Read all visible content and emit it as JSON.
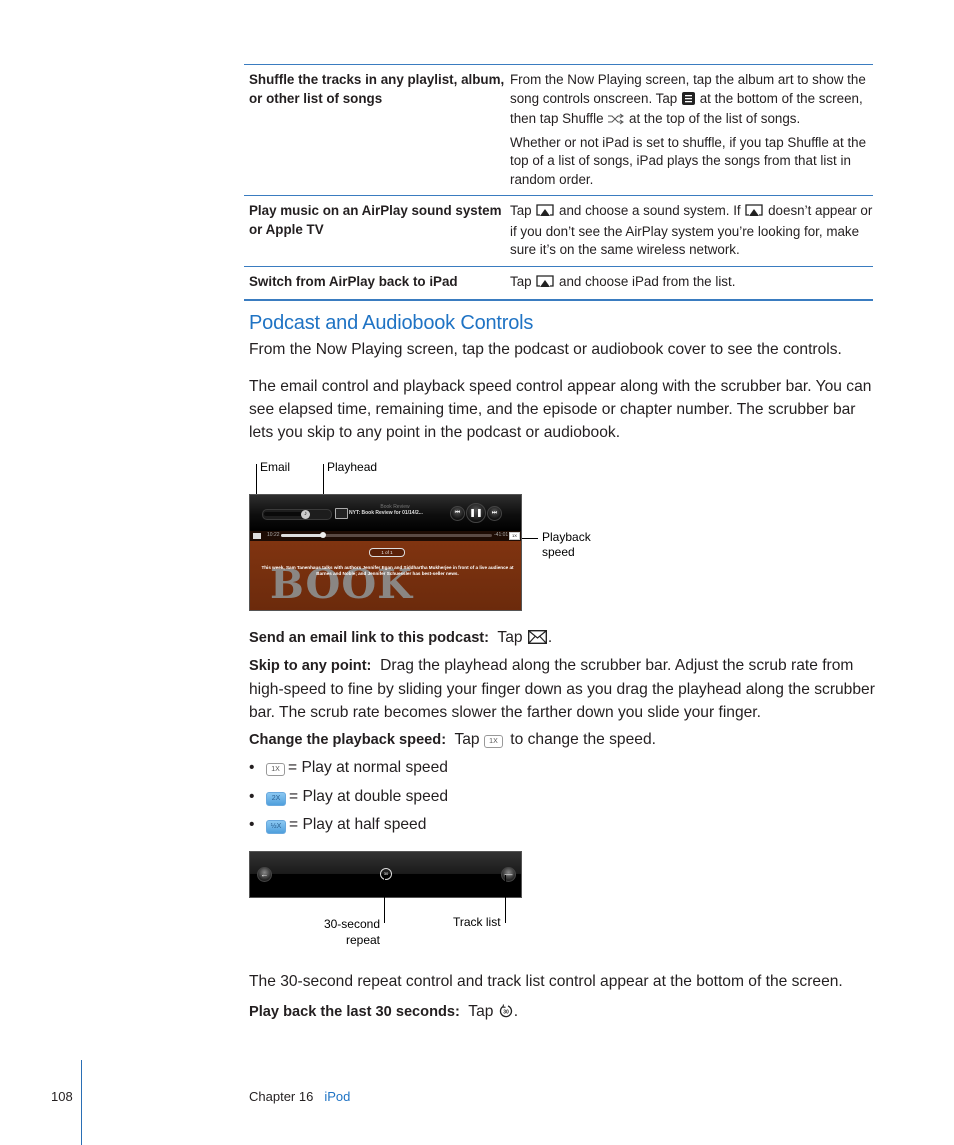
{
  "table": {
    "rows": [
      {
        "task": "Shuffle the tracks in any playlist, album, or other list of songs",
        "desc_parts": [
          "From the Now Playing screen, tap the album art to show the song controls onscreen. Tap ",
          " at the bottom of the screen, then tap Shuffle ",
          " at the top of the list of songs."
        ],
        "desc_icons": [
          "list-icon",
          "shuffle-icon"
        ],
        "desc2": "Whether or not iPad is set to shuffle, if you tap Shuffle at the top of a list of songs, iPad plays the songs from that list in random order."
      },
      {
        "task": "Play music on an AirPlay sound system or Apple TV",
        "desc_parts": [
          "Tap ",
          " and choose a sound system. If ",
          " doesn’t appear or if you don’t see the AirPlay system you’re looking for, make sure it’s on the same wireless network."
        ],
        "desc_icons": [
          "airplay-icon",
          "airplay-icon"
        ]
      },
      {
        "task": "Switch from AirPlay back to iPad",
        "desc_parts": [
          "Tap ",
          " and choose iPad from the list."
        ],
        "desc_icons": [
          "airplay-icon"
        ]
      }
    ]
  },
  "section": {
    "heading": "Podcast and Audiobook Controls",
    "intro": "From the Now Playing screen, tap the podcast or audiobook cover to see the controls.",
    "para2": "The email control and playback speed control appear along with the scrubber bar. You can see elapsed time, remaining time, and the episode or chapter number. The scrubber bar lets you skip to any point in the podcast or audiobook."
  },
  "figure1": {
    "callouts": {
      "email": "Email",
      "playhead": "Playhead",
      "playback_speed_line1": "Playback",
      "playback_speed_line2": "speed"
    },
    "screen": {
      "title": "Book Review",
      "subtitle": "NYT: Book Review for 01/14/2...",
      "elapsed": "10:22",
      "remaining": "-41:01",
      "progress_fraction": 0.2,
      "speed_badge": "1X",
      "episode_pill": "1 of 1",
      "description": "This week, Sam Tanenhaus talks with authors Jennifer Egan and Siddhartha Mukherjee in front of a live audience at Barnes and Noble; and Jennifer Schuessler has best-seller news.",
      "cover_text": "BOOK"
    }
  },
  "instructions": {
    "email_label": "Send an email link to this podcast:",
    "email_text_before": "Tap ",
    "email_text_after": ".",
    "skip_label": "Skip to any point:",
    "skip_text": "Drag the playhead along the scrubber bar. Adjust the scrub rate from high-speed to fine by sliding your finger down as you drag the playhead along the scrubber bar. The scrub rate becomes slower the farther down you slide your finger.",
    "speed_label": "Change the playback speed:",
    "speed_text_before": "Tap ",
    "speed_text_after": " to change the speed.",
    "speed_badge": "1X",
    "bullets": [
      {
        "badge": "1X",
        "style": "normal",
        "text": "= Play at normal speed"
      },
      {
        "badge": "2X",
        "style": "blue",
        "text": "= Play at double speed"
      },
      {
        "badge": "½X",
        "style": "blue",
        "text": "= Play at half speed"
      }
    ],
    "bullet_char": "•"
  },
  "figure2": {
    "callouts": {
      "repeat_line1": "30-second",
      "repeat_line2": "repeat",
      "track_list": "Track list"
    },
    "repeat_badge": "30"
  },
  "closing": {
    "para": "The 30-second repeat control and track list control appear at the bottom of the screen.",
    "repeat_label": "Play back the last 30 seconds:",
    "repeat_text_before": "Tap ",
    "repeat_text_after": "."
  },
  "footer": {
    "page_number": "108",
    "chapter": "Chapter 16",
    "chapter_link": "iPod"
  },
  "colors": {
    "accent_blue": "#1f73c4",
    "rule_blue": "#3a7cc0",
    "cover_brown": "#803410"
  }
}
